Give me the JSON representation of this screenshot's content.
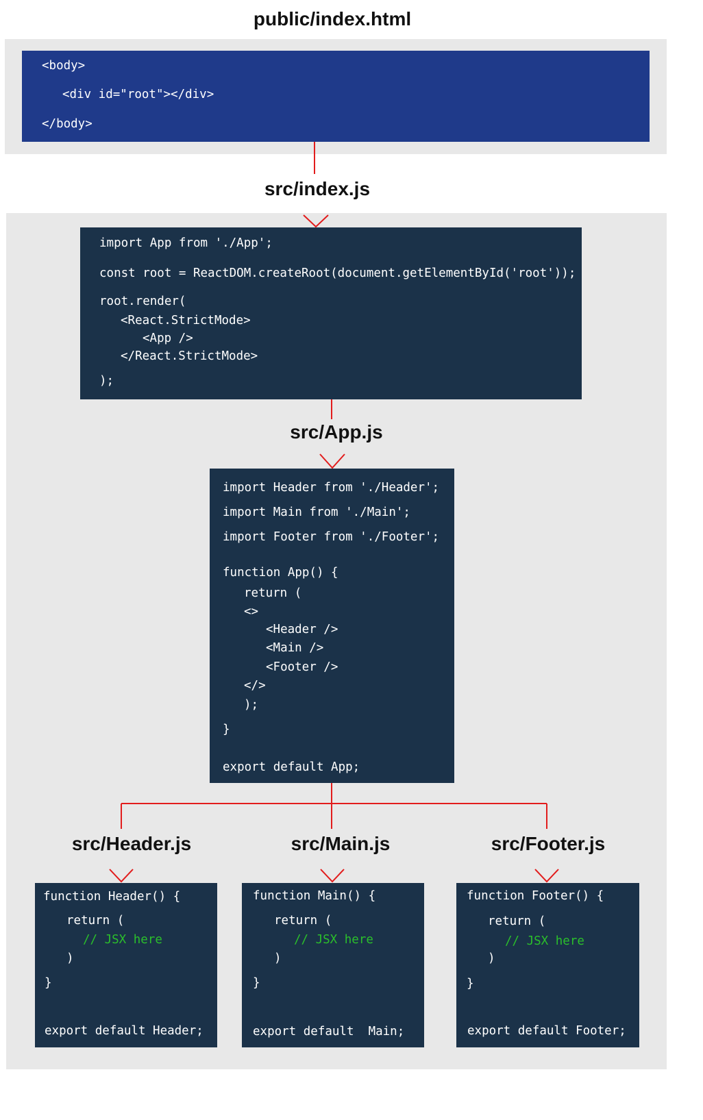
{
  "diagram": {
    "colors": {
      "connector": "#e21c1c",
      "panel": "#e8e8e8",
      "code_bg": "#1b3249",
      "html_bg": "#1f3a8a",
      "comment": "#2bbf2b"
    },
    "index_html": {
      "title": "public/index.html",
      "lines": [
        "<body>",
        "<div id=\"root\"></div>",
        "</body>"
      ]
    },
    "index_js": {
      "title": "src/index.js",
      "lines": [
        "import App from './App';",
        "const root = ReactDOM.createRoot(document.getElementById('root'));",
        "root.render(",
        "<React.StrictMode>",
        "<App />",
        "</React.StrictMode>",
        ");"
      ]
    },
    "app_js": {
      "title": "src/App.js",
      "lines": [
        "import Header from './Header';",
        "import Main from './Main';",
        "import Footer from './Footer';",
        "function App() {",
        "return (",
        "<>",
        "<Header />",
        "<Main />",
        "<Footer />",
        "</>",
        ");",
        "}",
        "export default App;"
      ]
    },
    "header_js": {
      "title": "src/Header.js",
      "lines": [
        "function Header() {",
        "return (",
        "// JSX here",
        ")",
        "}",
        "export default Header;"
      ]
    },
    "main_js": {
      "title": "src/Main.js",
      "lines": [
        "function Main() {",
        "return (",
        "// JSX here",
        ")",
        "}",
        "export default  Main;"
      ]
    },
    "footer_js": {
      "title": "src/Footer.js",
      "lines": [
        "function Footer() {",
        "return (",
        "// JSX here",
        ")",
        "}",
        "export default Footer;"
      ]
    }
  }
}
